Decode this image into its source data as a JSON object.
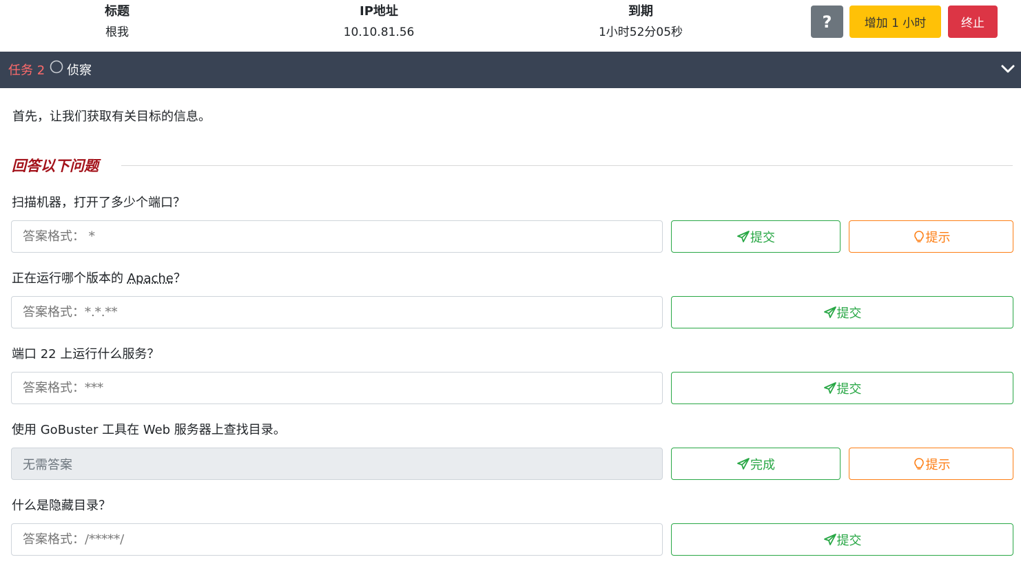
{
  "machine": {
    "title_label": "标题",
    "title_value": "根我",
    "ip_label": "IP地址",
    "ip_value": "10.10.81.56",
    "expires_label": "到期",
    "expires_value": "1小时52分05秒",
    "help_label": "?",
    "add_hour_label": "增加 1 小时",
    "terminate_label": "终止"
  },
  "task": {
    "number": "任务 2",
    "name": "侦察",
    "intro": "首先，让我们获取有关目标的信息。",
    "answer_heading": "回答以下问题"
  },
  "questions": [
    {
      "text": "扫描机器，打开了多少个端口？",
      "placeholder": "答案格式： *",
      "submit_label": "提交",
      "hint_label": "提示"
    },
    {
      "text_before": "正在运行哪个版本的 ",
      "text_abbr": "Apache",
      "text_after": "？",
      "placeholder": "答案格式：*.*.**",
      "submit_label": "提交"
    },
    {
      "text_before": "端口 ",
      "text_num": "22",
      "text_after": " 上运行什么服务？",
      "placeholder": "答案格式：***",
      "submit_label": "提交"
    },
    {
      "text_a": "使用 ",
      "text_b": "GoBuster",
      "text_c": " 工具在 ",
      "text_d": "Web",
      "text_e": " 服务器上查找目录。",
      "value": "无需答案",
      "complete_label": "完成",
      "hint_label": "提示"
    },
    {
      "text": "什么是隐藏目录？",
      "placeholder": "答案格式：/*****/",
      "submit_label": "提交"
    }
  ],
  "colors": {
    "header_bg": "#394354",
    "task_number": "#ff6b6b",
    "submit": "#28a745",
    "hint": "#fd7e14",
    "add_hour": "#ffc107",
    "terminate": "#dc3545",
    "help": "#6c757d"
  }
}
